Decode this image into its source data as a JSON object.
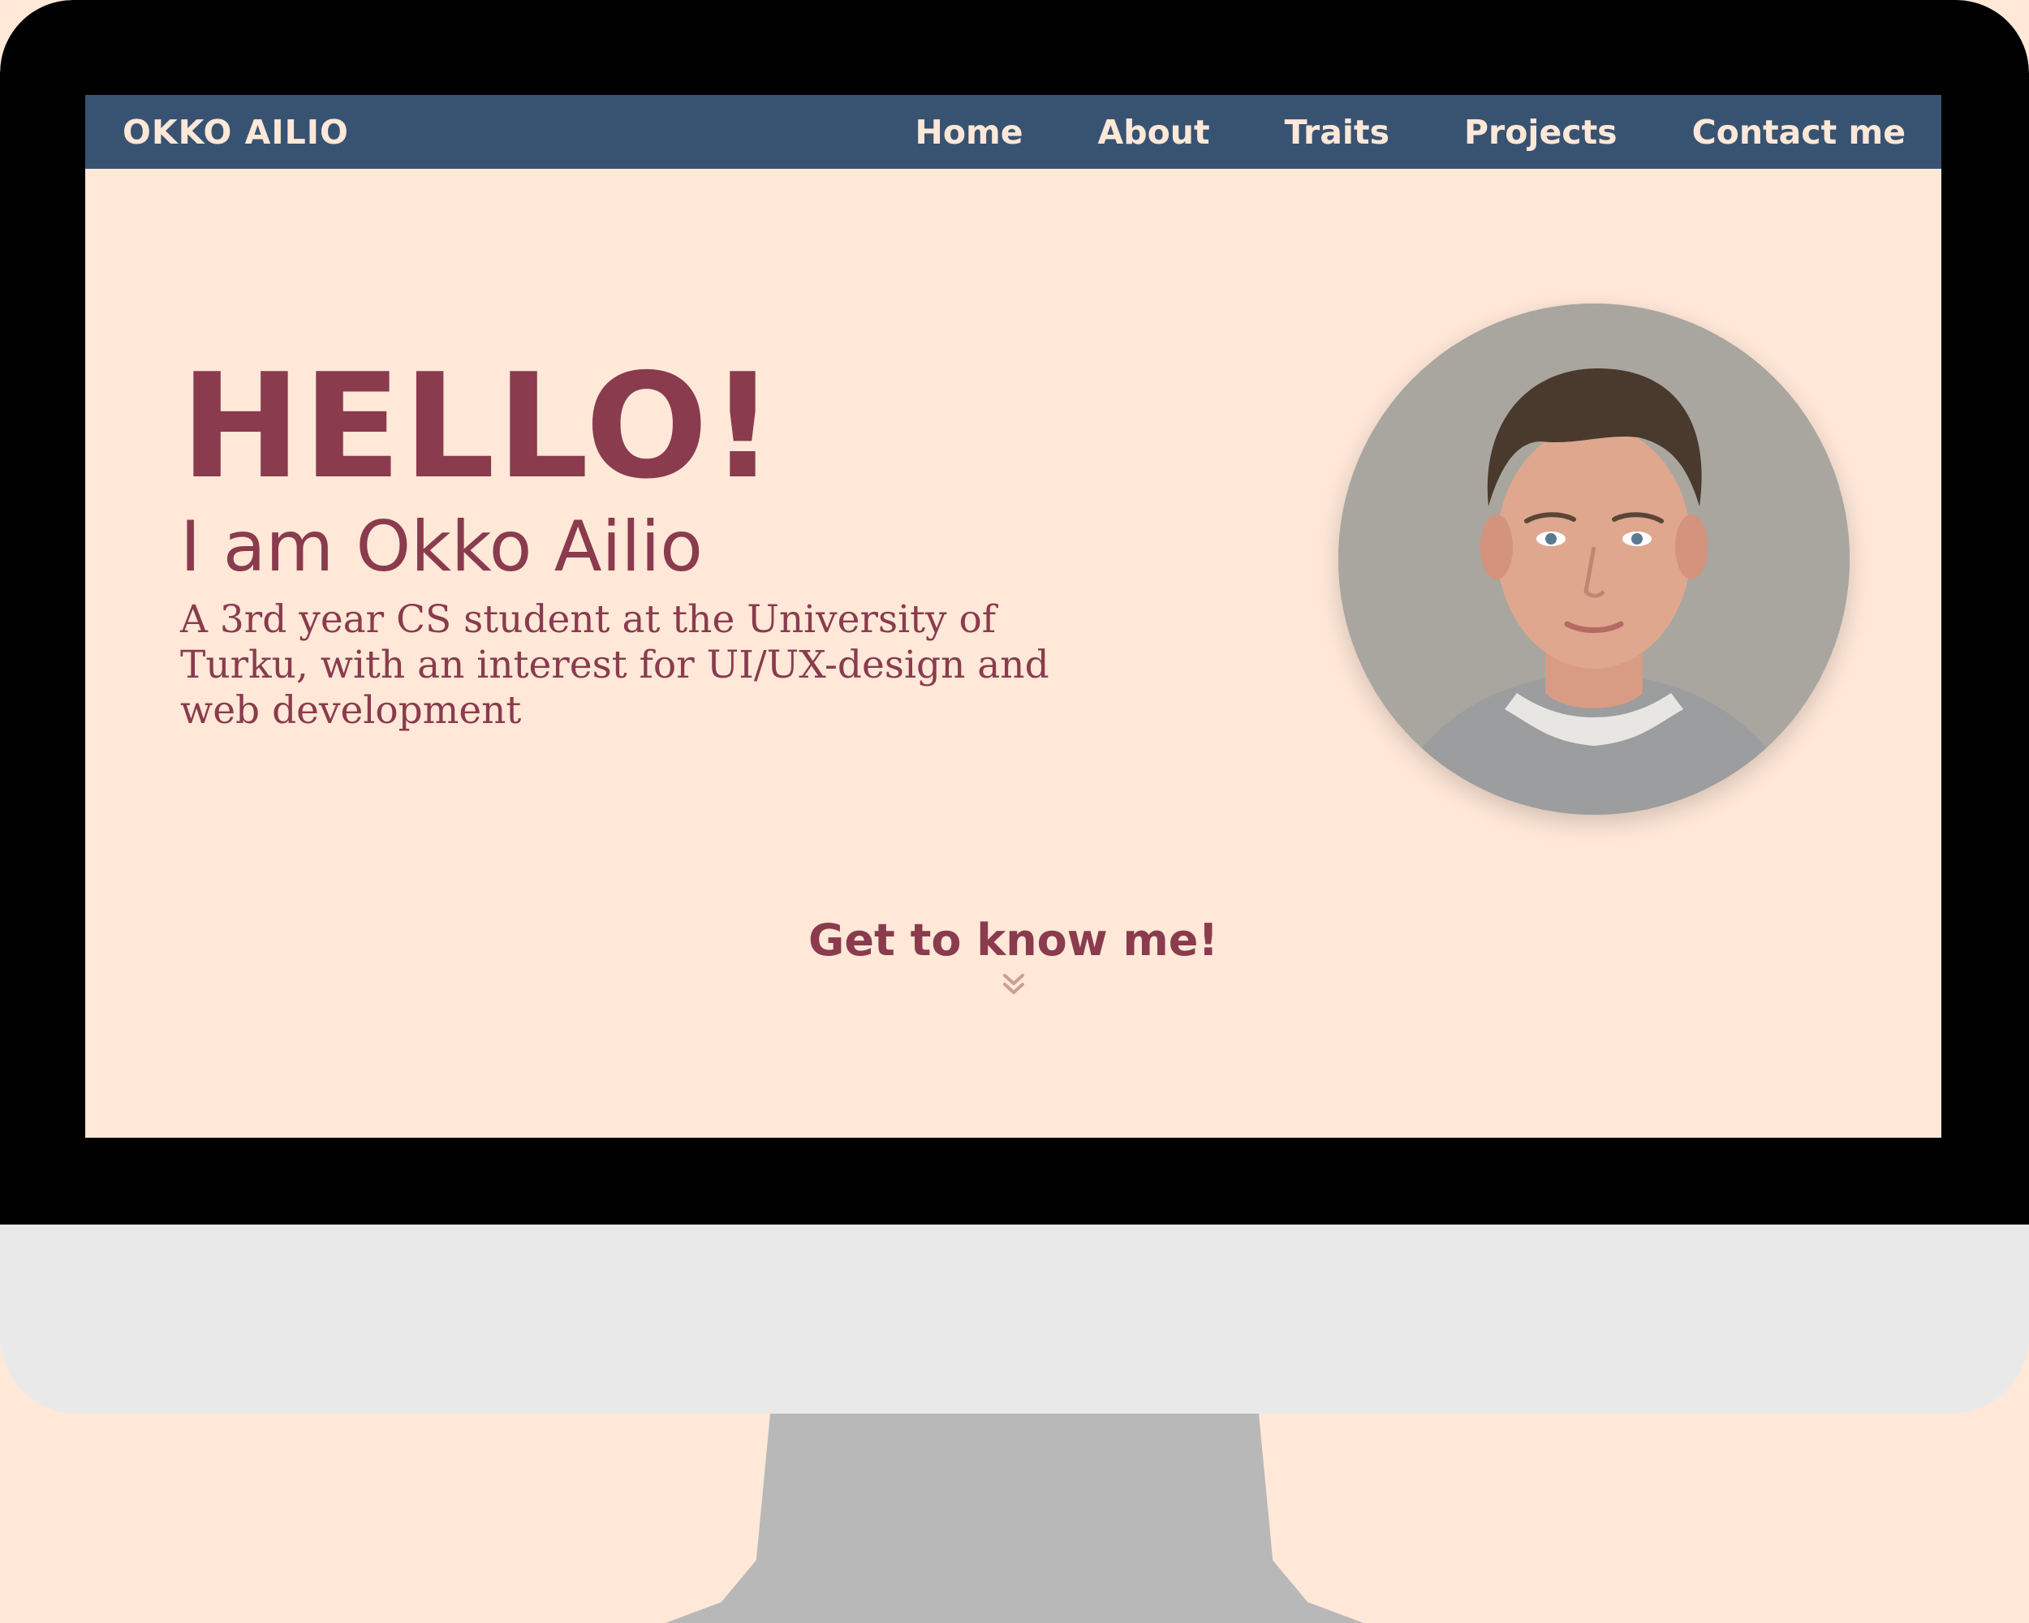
{
  "nav": {
    "brand": "OKKO AILIO",
    "links": [
      {
        "label": "Home"
      },
      {
        "label": "About"
      },
      {
        "label": "Traits"
      },
      {
        "label": "Projects"
      },
      {
        "label": "Contact me"
      }
    ]
  },
  "hero": {
    "greeting": "HELLO!",
    "name": "I am Okko Ailio",
    "tagline": "A 3rd year CS student at the University of Turku, with an interest for UI/UX-design and web development"
  },
  "cta": {
    "label": "Get to know me!",
    "icon": "double-chevron-down-icon"
  },
  "colors": {
    "background": "#ffe8d8",
    "navbar": "#385372",
    "accent": "#8a3b4d",
    "bezel": "#000000",
    "monitor_chin": "#e9e9e9",
    "stand": "#b8b8b8"
  }
}
